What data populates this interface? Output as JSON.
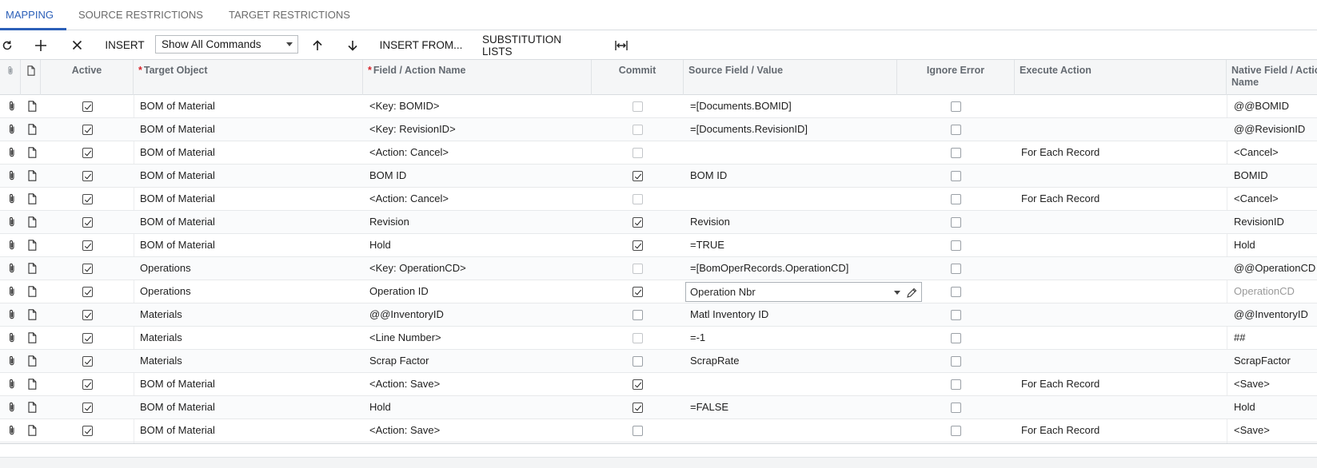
{
  "tabs": [
    {
      "label": "MAPPING",
      "active": true
    },
    {
      "label": "SOURCE RESTRICTIONS",
      "active": false
    },
    {
      "label": "TARGET RESTRICTIONS",
      "active": false
    }
  ],
  "toolbar": {
    "insert_label": "INSERT",
    "command_filter": "Show All Commands",
    "insert_from_label": "INSERT FROM...",
    "substitution_lists_label": "SUBSTITUTION LISTS"
  },
  "columns": {
    "active": "Active",
    "target_object": "Target Object",
    "field_action_name": "Field / Action Name",
    "commit": "Commit",
    "source_field_value": "Source Field / Value",
    "ignore_error": "Ignore Error",
    "execute_action": "Execute Action",
    "native_field_action_name_line1": "Native Field / Action",
    "native_field_action_name_line2": "Name"
  },
  "colors": {
    "accent": "#2b5fb8",
    "required": "#d6252b",
    "header_bg": "#f5f6f7"
  },
  "rows": [
    {
      "active": true,
      "target_object": "BOM of Material",
      "field": "<Key: BOMID>",
      "commit": false,
      "commit_disabled": true,
      "source": "=[Documents.BOMID]",
      "ignore_error": false,
      "execute_action": "",
      "native": "@@BOMID"
    },
    {
      "active": true,
      "target_object": "BOM of Material",
      "field": "<Key: RevisionID>",
      "commit": false,
      "commit_disabled": true,
      "source": "=[Documents.RevisionID]",
      "ignore_error": false,
      "execute_action": "",
      "native": "@@RevisionID"
    },
    {
      "active": true,
      "target_object": "BOM of Material",
      "field": "<Action: Cancel>",
      "commit": false,
      "commit_disabled": true,
      "source": "",
      "ignore_error": false,
      "execute_action": "For Each Record",
      "native": "<Cancel>"
    },
    {
      "active": true,
      "target_object": "BOM of Material",
      "field": "BOM ID",
      "commit": true,
      "commit_disabled": false,
      "source": "BOM ID",
      "ignore_error": false,
      "execute_action": "",
      "native": "BOMID"
    },
    {
      "active": true,
      "target_object": "BOM of Material",
      "field": "<Action: Cancel>",
      "commit": false,
      "commit_disabled": true,
      "source": "",
      "ignore_error": false,
      "execute_action": "For Each Record",
      "native": "<Cancel>"
    },
    {
      "active": true,
      "target_object": "BOM of Material",
      "field": "Revision",
      "commit": true,
      "commit_disabled": false,
      "source": "Revision",
      "ignore_error": false,
      "execute_action": "",
      "native": "RevisionID"
    },
    {
      "active": true,
      "target_object": "BOM of Material",
      "field": "Hold",
      "commit": true,
      "commit_disabled": false,
      "source": "=TRUE",
      "ignore_error": false,
      "execute_action": "",
      "native": "Hold"
    },
    {
      "active": true,
      "target_object": "Operations",
      "field": "<Key: OperationCD>",
      "commit": false,
      "commit_disabled": true,
      "source": "=[BomOperRecords.OperationCD]",
      "ignore_error": false,
      "execute_action": "",
      "native": "@@OperationCD"
    },
    {
      "active": true,
      "target_object": "Operations",
      "field": "Operation ID",
      "commit": true,
      "commit_disabled": false,
      "source": "Operation Nbr",
      "editing": true,
      "ignore_error": false,
      "execute_action": "",
      "native": "OperationCD",
      "native_muted": true
    },
    {
      "active": true,
      "target_object": "Materials",
      "field": "@@InventoryID",
      "commit": false,
      "commit_disabled": false,
      "source": "Matl Inventory ID",
      "ignore_error": false,
      "execute_action": "",
      "native": "@@InventoryID"
    },
    {
      "active": true,
      "target_object": "Materials",
      "field": "<Line Number>",
      "commit": false,
      "commit_disabled": true,
      "source": "=-1",
      "ignore_error": false,
      "execute_action": "",
      "native": "##"
    },
    {
      "active": true,
      "target_object": "Materials",
      "field": "Scrap Factor",
      "commit": false,
      "commit_disabled": false,
      "source": "ScrapRate",
      "ignore_error": false,
      "execute_action": "",
      "native": "ScrapFactor"
    },
    {
      "active": true,
      "target_object": "BOM of Material",
      "field": "<Action: Save>",
      "commit": true,
      "commit_disabled": false,
      "source": "",
      "ignore_error": false,
      "execute_action": "For Each Record",
      "native": "<Save>"
    },
    {
      "active": true,
      "target_object": "BOM of Material",
      "field": "Hold",
      "commit": true,
      "commit_disabled": false,
      "source": "=FALSE",
      "ignore_error": false,
      "execute_action": "",
      "native": "Hold"
    },
    {
      "active": true,
      "target_object": "BOM of Material",
      "field": "<Action: Save>",
      "commit": false,
      "commit_disabled": false,
      "source": "",
      "ignore_error": false,
      "execute_action": "For Each Record",
      "native": "<Save>"
    }
  ]
}
